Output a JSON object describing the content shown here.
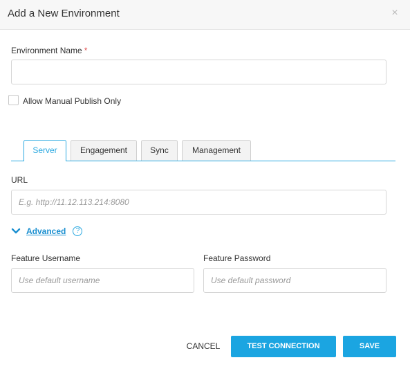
{
  "dialog": {
    "title": "Add a New Environment",
    "close_glyph": "×"
  },
  "form": {
    "env_name_label": "Environment Name",
    "required_marker": "*",
    "env_name_value": "",
    "allow_manual_label": "Allow Manual Publish Only",
    "allow_manual_checked": false
  },
  "tabs": [
    {
      "label": "Server",
      "active": true
    },
    {
      "label": "Engagement",
      "active": false
    },
    {
      "label": "Sync",
      "active": false
    },
    {
      "label": "Management",
      "active": false
    }
  ],
  "server": {
    "url_label": "URL",
    "url_placeholder": "E.g. http://11.12.113.214:8080",
    "advanced_label": "Advanced",
    "help_glyph": "?",
    "feature_username_label": "Feature Username",
    "feature_username_placeholder": "Use default username",
    "feature_password_label": "Feature Password",
    "feature_password_placeholder": "Use default password"
  },
  "footer": {
    "cancel_label": "CANCEL",
    "test_label": "TEST CONNECTION",
    "save_label": "SAVE"
  },
  "colors": {
    "accent": "#1ba5e1",
    "required": "#e05252"
  }
}
